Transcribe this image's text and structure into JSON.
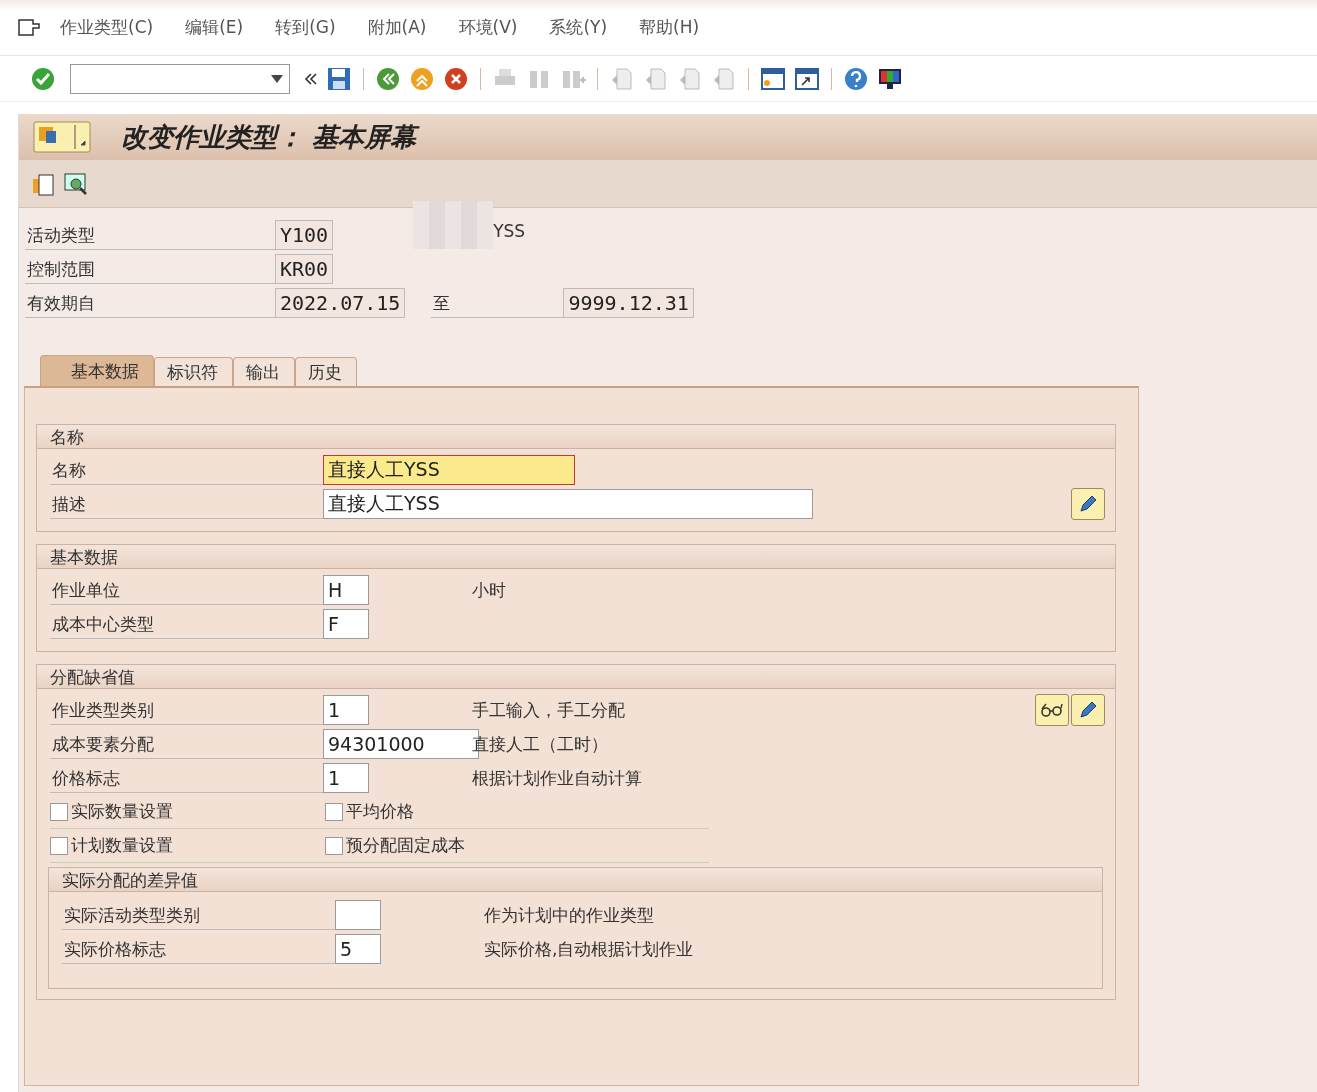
{
  "menu": [
    {
      "label": "作业类型(C)"
    },
    {
      "label": "编辑(E)"
    },
    {
      "label": "转到(G)"
    },
    {
      "label": "附加(A)"
    },
    {
      "label": "环境(V)"
    },
    {
      "label": "系统(Y)"
    },
    {
      "label": "帮助(H)"
    }
  ],
  "title": "改变作业类型： 基本屏幕",
  "header": [
    {
      "label": "活动类型",
      "value": "Y100",
      "note": "YSS"
    },
    {
      "label": "控制范围",
      "value": "KR00"
    },
    {
      "label": "有效期自",
      "value": "2022.07.15",
      "to_label": "至",
      "to_value": "9999.12.31"
    }
  ],
  "tabs": [
    {
      "label": "基本数据",
      "selected": true
    },
    {
      "label": "标识符",
      "selected": false
    },
    {
      "label": "输出",
      "selected": false
    },
    {
      "label": "历史",
      "selected": false
    }
  ],
  "groups": [
    {
      "title": "名称",
      "rows": [
        {
          "kind": "field",
          "label": "名称",
          "value": "直接人工YSS",
          "focused": true
        },
        {
          "kind": "field",
          "label": "描述",
          "value": "直接人工YSS",
          "focused": false,
          "wide": true,
          "edit_button": true
        }
      ]
    },
    {
      "title": "基本数据",
      "rows": [
        {
          "kind": "field",
          "label": "作业单位",
          "value": "H",
          "focused": false,
          "note": "小时"
        },
        {
          "kind": "field",
          "label": "成本中心类型",
          "value": "F",
          "focused": false
        }
      ]
    },
    {
      "title": "分配缺省值",
      "rows": [
        {
          "kind": "field",
          "label": "作业类型类别",
          "value": "1",
          "focused": false,
          "note": "手工输入，手工分配",
          "edit_button": true,
          "display_button": true
        },
        {
          "kind": "field",
          "label": "成本要素分配",
          "value": "94301000",
          "focused": false,
          "note": "直接人工（工时）"
        },
        {
          "kind": "field",
          "label": "价格标志",
          "value": "1",
          "focused": false,
          "note": "根据计划作业自动计算"
        },
        {
          "kind": "checks",
          "items": [
            {
              "label": "实际数量设置",
              "checked": false
            },
            {
              "label": "平均价格",
              "checked": false
            }
          ]
        },
        {
          "kind": "checks",
          "items": [
            {
              "label": "计划数量设置",
              "checked": false
            },
            {
              "label": "预分配固定成本",
              "checked": false
            }
          ]
        }
      ],
      "subgroup": {
        "title": "实际分配的差异值",
        "rows": [
          {
            "kind": "field",
            "label": "实际活动类型类别",
            "value": "",
            "focused": false,
            "note": "作为计划中的作业类型"
          },
          {
            "kind": "field",
            "label": "实际价格标志",
            "value": "5",
            "focused": false,
            "note": "实际价格,自动根据计划作业"
          }
        ]
      }
    }
  ]
}
